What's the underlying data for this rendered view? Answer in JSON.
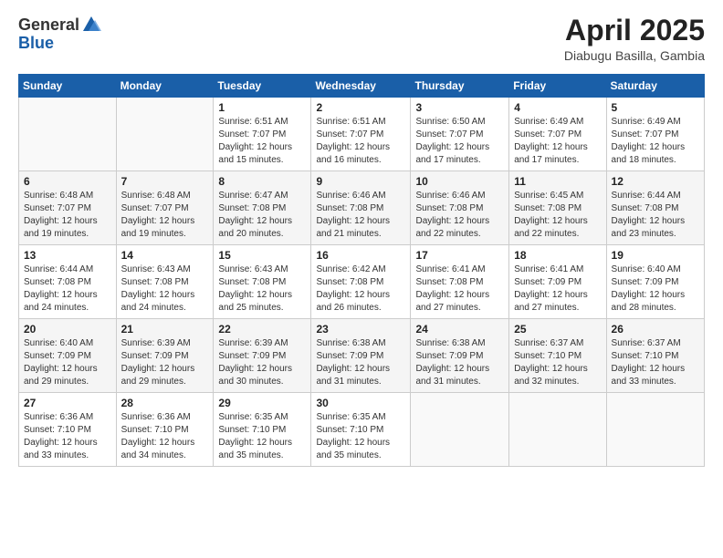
{
  "header": {
    "logo_general": "General",
    "logo_blue": "Blue",
    "title": "April 2025",
    "location": "Diabugu Basilla, Gambia"
  },
  "days_of_week": [
    "Sunday",
    "Monday",
    "Tuesday",
    "Wednesday",
    "Thursday",
    "Friday",
    "Saturday"
  ],
  "weeks": [
    [
      {
        "day": "",
        "sunrise": "",
        "sunset": "",
        "daylight": ""
      },
      {
        "day": "",
        "sunrise": "",
        "sunset": "",
        "daylight": ""
      },
      {
        "day": "1",
        "sunrise": "Sunrise: 6:51 AM",
        "sunset": "Sunset: 7:07 PM",
        "daylight": "Daylight: 12 hours and 15 minutes."
      },
      {
        "day": "2",
        "sunrise": "Sunrise: 6:51 AM",
        "sunset": "Sunset: 7:07 PM",
        "daylight": "Daylight: 12 hours and 16 minutes."
      },
      {
        "day": "3",
        "sunrise": "Sunrise: 6:50 AM",
        "sunset": "Sunset: 7:07 PM",
        "daylight": "Daylight: 12 hours and 17 minutes."
      },
      {
        "day": "4",
        "sunrise": "Sunrise: 6:49 AM",
        "sunset": "Sunset: 7:07 PM",
        "daylight": "Daylight: 12 hours and 17 minutes."
      },
      {
        "day": "5",
        "sunrise": "Sunrise: 6:49 AM",
        "sunset": "Sunset: 7:07 PM",
        "daylight": "Daylight: 12 hours and 18 minutes."
      }
    ],
    [
      {
        "day": "6",
        "sunrise": "Sunrise: 6:48 AM",
        "sunset": "Sunset: 7:07 PM",
        "daylight": "Daylight: 12 hours and 19 minutes."
      },
      {
        "day": "7",
        "sunrise": "Sunrise: 6:48 AM",
        "sunset": "Sunset: 7:07 PM",
        "daylight": "Daylight: 12 hours and 19 minutes."
      },
      {
        "day": "8",
        "sunrise": "Sunrise: 6:47 AM",
        "sunset": "Sunset: 7:08 PM",
        "daylight": "Daylight: 12 hours and 20 minutes."
      },
      {
        "day": "9",
        "sunrise": "Sunrise: 6:46 AM",
        "sunset": "Sunset: 7:08 PM",
        "daylight": "Daylight: 12 hours and 21 minutes."
      },
      {
        "day": "10",
        "sunrise": "Sunrise: 6:46 AM",
        "sunset": "Sunset: 7:08 PM",
        "daylight": "Daylight: 12 hours and 22 minutes."
      },
      {
        "day": "11",
        "sunrise": "Sunrise: 6:45 AM",
        "sunset": "Sunset: 7:08 PM",
        "daylight": "Daylight: 12 hours and 22 minutes."
      },
      {
        "day": "12",
        "sunrise": "Sunrise: 6:44 AM",
        "sunset": "Sunset: 7:08 PM",
        "daylight": "Daylight: 12 hours and 23 minutes."
      }
    ],
    [
      {
        "day": "13",
        "sunrise": "Sunrise: 6:44 AM",
        "sunset": "Sunset: 7:08 PM",
        "daylight": "Daylight: 12 hours and 24 minutes."
      },
      {
        "day": "14",
        "sunrise": "Sunrise: 6:43 AM",
        "sunset": "Sunset: 7:08 PM",
        "daylight": "Daylight: 12 hours and 24 minutes."
      },
      {
        "day": "15",
        "sunrise": "Sunrise: 6:43 AM",
        "sunset": "Sunset: 7:08 PM",
        "daylight": "Daylight: 12 hours and 25 minutes."
      },
      {
        "day": "16",
        "sunrise": "Sunrise: 6:42 AM",
        "sunset": "Sunset: 7:08 PM",
        "daylight": "Daylight: 12 hours and 26 minutes."
      },
      {
        "day": "17",
        "sunrise": "Sunrise: 6:41 AM",
        "sunset": "Sunset: 7:08 PM",
        "daylight": "Daylight: 12 hours and 27 minutes."
      },
      {
        "day": "18",
        "sunrise": "Sunrise: 6:41 AM",
        "sunset": "Sunset: 7:09 PM",
        "daylight": "Daylight: 12 hours and 27 minutes."
      },
      {
        "day": "19",
        "sunrise": "Sunrise: 6:40 AM",
        "sunset": "Sunset: 7:09 PM",
        "daylight": "Daylight: 12 hours and 28 minutes."
      }
    ],
    [
      {
        "day": "20",
        "sunrise": "Sunrise: 6:40 AM",
        "sunset": "Sunset: 7:09 PM",
        "daylight": "Daylight: 12 hours and 29 minutes."
      },
      {
        "day": "21",
        "sunrise": "Sunrise: 6:39 AM",
        "sunset": "Sunset: 7:09 PM",
        "daylight": "Daylight: 12 hours and 29 minutes."
      },
      {
        "day": "22",
        "sunrise": "Sunrise: 6:39 AM",
        "sunset": "Sunset: 7:09 PM",
        "daylight": "Daylight: 12 hours and 30 minutes."
      },
      {
        "day": "23",
        "sunrise": "Sunrise: 6:38 AM",
        "sunset": "Sunset: 7:09 PM",
        "daylight": "Daylight: 12 hours and 31 minutes."
      },
      {
        "day": "24",
        "sunrise": "Sunrise: 6:38 AM",
        "sunset": "Sunset: 7:09 PM",
        "daylight": "Daylight: 12 hours and 31 minutes."
      },
      {
        "day": "25",
        "sunrise": "Sunrise: 6:37 AM",
        "sunset": "Sunset: 7:10 PM",
        "daylight": "Daylight: 12 hours and 32 minutes."
      },
      {
        "day": "26",
        "sunrise": "Sunrise: 6:37 AM",
        "sunset": "Sunset: 7:10 PM",
        "daylight": "Daylight: 12 hours and 33 minutes."
      }
    ],
    [
      {
        "day": "27",
        "sunrise": "Sunrise: 6:36 AM",
        "sunset": "Sunset: 7:10 PM",
        "daylight": "Daylight: 12 hours and 33 minutes."
      },
      {
        "day": "28",
        "sunrise": "Sunrise: 6:36 AM",
        "sunset": "Sunset: 7:10 PM",
        "daylight": "Daylight: 12 hours and 34 minutes."
      },
      {
        "day": "29",
        "sunrise": "Sunrise: 6:35 AM",
        "sunset": "Sunset: 7:10 PM",
        "daylight": "Daylight: 12 hours and 35 minutes."
      },
      {
        "day": "30",
        "sunrise": "Sunrise: 6:35 AM",
        "sunset": "Sunset: 7:10 PM",
        "daylight": "Daylight: 12 hours and 35 minutes."
      },
      {
        "day": "",
        "sunrise": "",
        "sunset": "",
        "daylight": ""
      },
      {
        "day": "",
        "sunrise": "",
        "sunset": "",
        "daylight": ""
      },
      {
        "day": "",
        "sunrise": "",
        "sunset": "",
        "daylight": ""
      }
    ]
  ]
}
